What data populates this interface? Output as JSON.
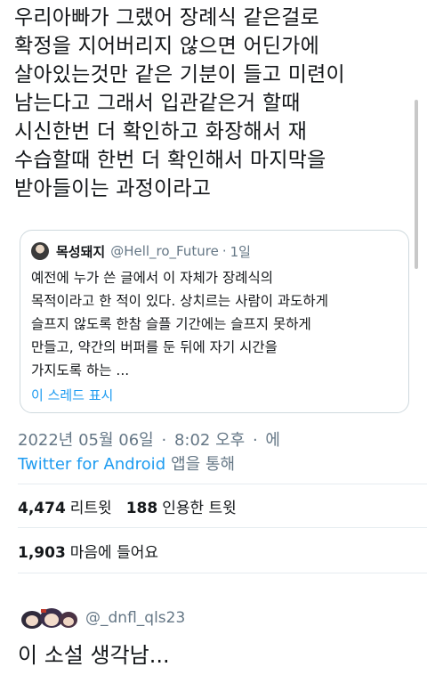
{
  "tweet": {
    "text": "우리아빠가 그랬어 장례식 같은걸로\n확정을 지어버리지 않으면 어딘가에\n살아있는것만 같은 기분이 들고 미련이\n남는다고 그래서 입관같은거 할때\n시신한번 더 확인하고 화장해서 재\n수습할때 한번 더 확인해서 마지막을\n받아들이는 과정이라고"
  },
  "quote": {
    "display_name": "목성돼지",
    "handle": "@Hell_ro_Future",
    "separator": "·",
    "time": "1일",
    "text": "예전에 누가 쓴 글에서 이 자체가 장례식의\n목적이라고 한 적이 있다. 상치르는 사람이 과도하게\n슬프지 않도록 한참 슬플 기간에는 슬프지 못하게\n만들고, 약간의 버퍼를 둔 뒤에 자기 시간을\n가지도록 하는 ...",
    "thread_link": "이 스레드 표시"
  },
  "meta": {
    "date": "2022년 05월 06일",
    "sep1": "·",
    "time": "8:02 오후",
    "sep2": "·",
    "trailing": "에",
    "source_app": "Twitter for Android",
    "source_suffix": "앱을 통해"
  },
  "stats": {
    "retweets_count": "4,474",
    "retweets_label": "리트윗",
    "quotes_count": "188",
    "quotes_label": "인용한 트윗",
    "likes_count": "1,903",
    "likes_label": "마음에 들어요"
  },
  "reply": {
    "handle": "@_dnfl_qls23",
    "text": "이 소설 생각남..."
  },
  "colors": {
    "link": "#1d9bf0",
    "muted": "#657786",
    "text": "#14171a",
    "border": "#cfd9de"
  }
}
